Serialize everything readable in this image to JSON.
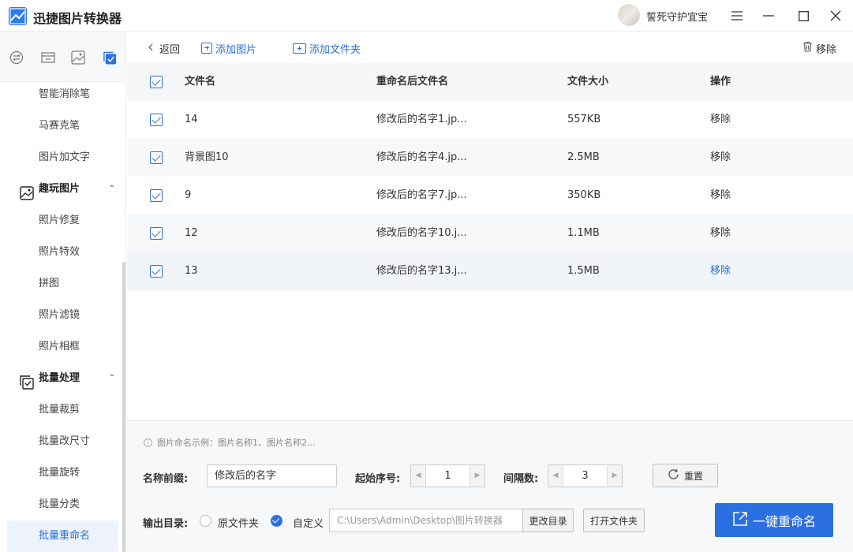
{
  "app": {
    "title": "迅捷图片转换器",
    "username": "誓死守护宜宝"
  },
  "sidebar": {
    "items_top": [
      "智能消除笔",
      "马赛克笔",
      "图片加文字"
    ],
    "group_fun": {
      "label": "趣玩图片",
      "items": [
        "照片修复",
        "照片特效",
        "拼图",
        "照片滤镜",
        "照片相框"
      ]
    },
    "group_batch": {
      "label": "批量处理",
      "items": [
        "批量裁剪",
        "批量改尺寸",
        "批量旋转",
        "批量分类",
        "批量重命名"
      ]
    }
  },
  "toolbar": {
    "back": "返回",
    "add_image": "添加图片",
    "add_folder": "添加文件夹",
    "remove": "移除"
  },
  "table": {
    "headers": {
      "filename": "文件名",
      "renamed": "重命名后文件名",
      "size": "文件大小",
      "action": "操作"
    },
    "rows": [
      {
        "name": "14",
        "renamed": "修改后的名字1.jp...",
        "size": "557KB",
        "action": "移除"
      },
      {
        "name": "背景图10",
        "renamed": "修改后的名字4.jp...",
        "size": "2.5MB",
        "action": "移除"
      },
      {
        "name": "9",
        "renamed": "修改后的名字7.jp...",
        "size": "350KB",
        "action": "移除"
      },
      {
        "name": "12",
        "renamed": "修改后的名字10.j...",
        "size": "1.1MB",
        "action": "移除"
      },
      {
        "name": "13",
        "renamed": "修改后的名字13.j...",
        "size": "1.5MB",
        "action": "移除"
      }
    ]
  },
  "settings": {
    "hint": "图片命名示例：图片名称1、图片名称2...",
    "prefix_label": "名称前缀:",
    "prefix_value": "修改后的名字",
    "start_label": "起始序号:",
    "start_value": "1",
    "interval_label": "间隔数:",
    "interval_value": "3",
    "reset": "重置",
    "output_label": "输出目录:",
    "opt_original": "原文件夹",
    "opt_custom": "自定义",
    "path": "C:\\Users\\Admin\\Desktop\\图片转换器",
    "change_dir": "更改目录",
    "open_folder": "打开文件夹",
    "rename_all": "一键重命名"
  },
  "colors": {
    "accent": "#2b6fe0",
    "sidebar_active_bg": "#edf2fc"
  }
}
